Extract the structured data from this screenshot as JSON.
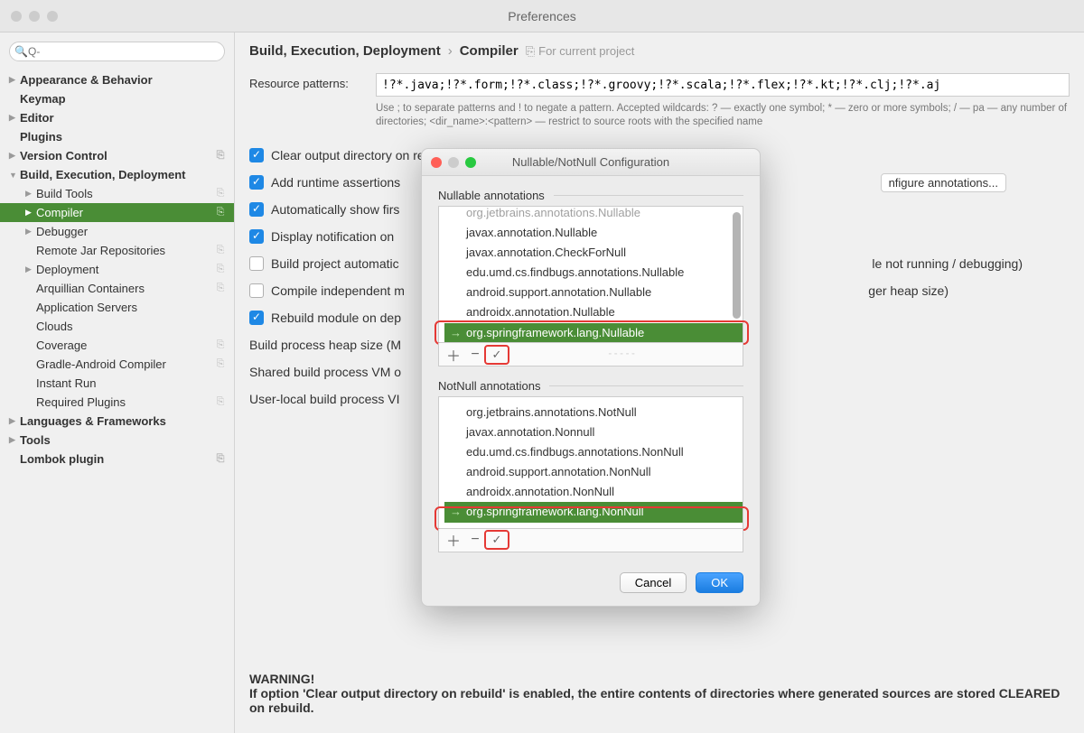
{
  "window_title": "Preferences",
  "search_placeholder": "Q-",
  "sidebar": {
    "items": [
      {
        "label": "Appearance & Behavior",
        "bold": true,
        "arrow": "▶"
      },
      {
        "label": "Keymap",
        "bold": true
      },
      {
        "label": "Editor",
        "bold": true,
        "arrow": "▶"
      },
      {
        "label": "Plugins",
        "bold": true
      },
      {
        "label": "Version Control",
        "bold": true,
        "arrow": "▶",
        "badge": "⎘"
      },
      {
        "label": "Build, Execution, Deployment",
        "bold": true,
        "arrow": "▼"
      },
      {
        "label": "Build Tools",
        "indent": 1,
        "arrow": "▶",
        "badge": "⎘"
      },
      {
        "label": "Compiler",
        "indent": 1,
        "arrow": "▶",
        "selected": true,
        "badge": "⎘"
      },
      {
        "label": "Debugger",
        "indent": 1,
        "arrow": "▶"
      },
      {
        "label": "Remote Jar Repositories",
        "indent": 1,
        "badge": "⎘"
      },
      {
        "label": "Deployment",
        "indent": 1,
        "arrow": "▶",
        "badge": "⎘"
      },
      {
        "label": "Arquillian Containers",
        "indent": 1,
        "badge": "⎘"
      },
      {
        "label": "Application Servers",
        "indent": 1
      },
      {
        "label": "Clouds",
        "indent": 1
      },
      {
        "label": "Coverage",
        "indent": 1,
        "badge": "⎘"
      },
      {
        "label": "Gradle-Android Compiler",
        "indent": 1,
        "badge": "⎘"
      },
      {
        "label": "Instant Run",
        "indent": 1
      },
      {
        "label": "Required Plugins",
        "indent": 1,
        "badge": "⎘"
      },
      {
        "label": "Languages & Frameworks",
        "bold": true,
        "arrow": "▶"
      },
      {
        "label": "Tools",
        "bold": true,
        "arrow": "▶"
      },
      {
        "label": "Lombok plugin",
        "bold": true,
        "badge": "⎘"
      }
    ]
  },
  "breadcrumb": {
    "p1": "Build, Execution, Deployment",
    "sep": "›",
    "p2": "Compiler",
    "meta": "For current project"
  },
  "resource_label": "Resource patterns:",
  "resource_value": "!?*.java;!?*.form;!?*.class;!?*.groovy;!?*.scala;!?*.flex;!?*.kt;!?*.clj;!?*.aj",
  "hint": "Use ; to separate patterns and ! to negate a pattern. Accepted wildcards: ? — exactly one symbol; * — zero or more symbols; / — pa — any number of directories; <dir_name>:<pattern> — restrict to source roots with the specified name",
  "checks": {
    "c1": "Clear output directory on rebuild",
    "c2": "Add runtime assertions",
    "c3": "Automatically show firs",
    "c4": "Display notification on",
    "c5": "Build project automatic",
    "c5_tail": "le not running / debugging)",
    "c6": "Compile independent m",
    "c6_tail": "ger heap size)",
    "c7": "Rebuild module on dep"
  },
  "conf_btn_tail": "nfigure annotations...",
  "rows": {
    "r1": "Build process heap size (M",
    "r2": "Shared build process VM o",
    "r3": "User-local build process VI"
  },
  "warning_title": "WARNING!",
  "warning_body": "If option 'Clear output directory on rebuild' is enabled, the entire contents of directories where generated sources are stored CLEARED on rebuild.",
  "modal": {
    "title": "Nullable/NotNull Configuration",
    "sec1": "Nullable annotations",
    "list1": [
      "org.jetbrains.annotations.Nullable",
      "javax.annotation.Nullable",
      "javax.annotation.CheckForNull",
      "edu.umd.cs.findbugs.annotations.Nullable",
      "android.support.annotation.Nullable",
      "androidx.annotation.Nullable",
      "org.springframework.lang.Nullable"
    ],
    "sec2": "NotNull annotations",
    "list2": [
      "org.jetbrains.annotations.NotNull",
      "javax.annotation.Nonnull",
      "edu.umd.cs.findbugs.annotations.NonNull",
      "android.support.annotation.NonNull",
      "androidx.annotation.NonNull",
      "org.springframework.lang.NonNull"
    ],
    "cancel": "Cancel",
    "ok": "OK"
  }
}
